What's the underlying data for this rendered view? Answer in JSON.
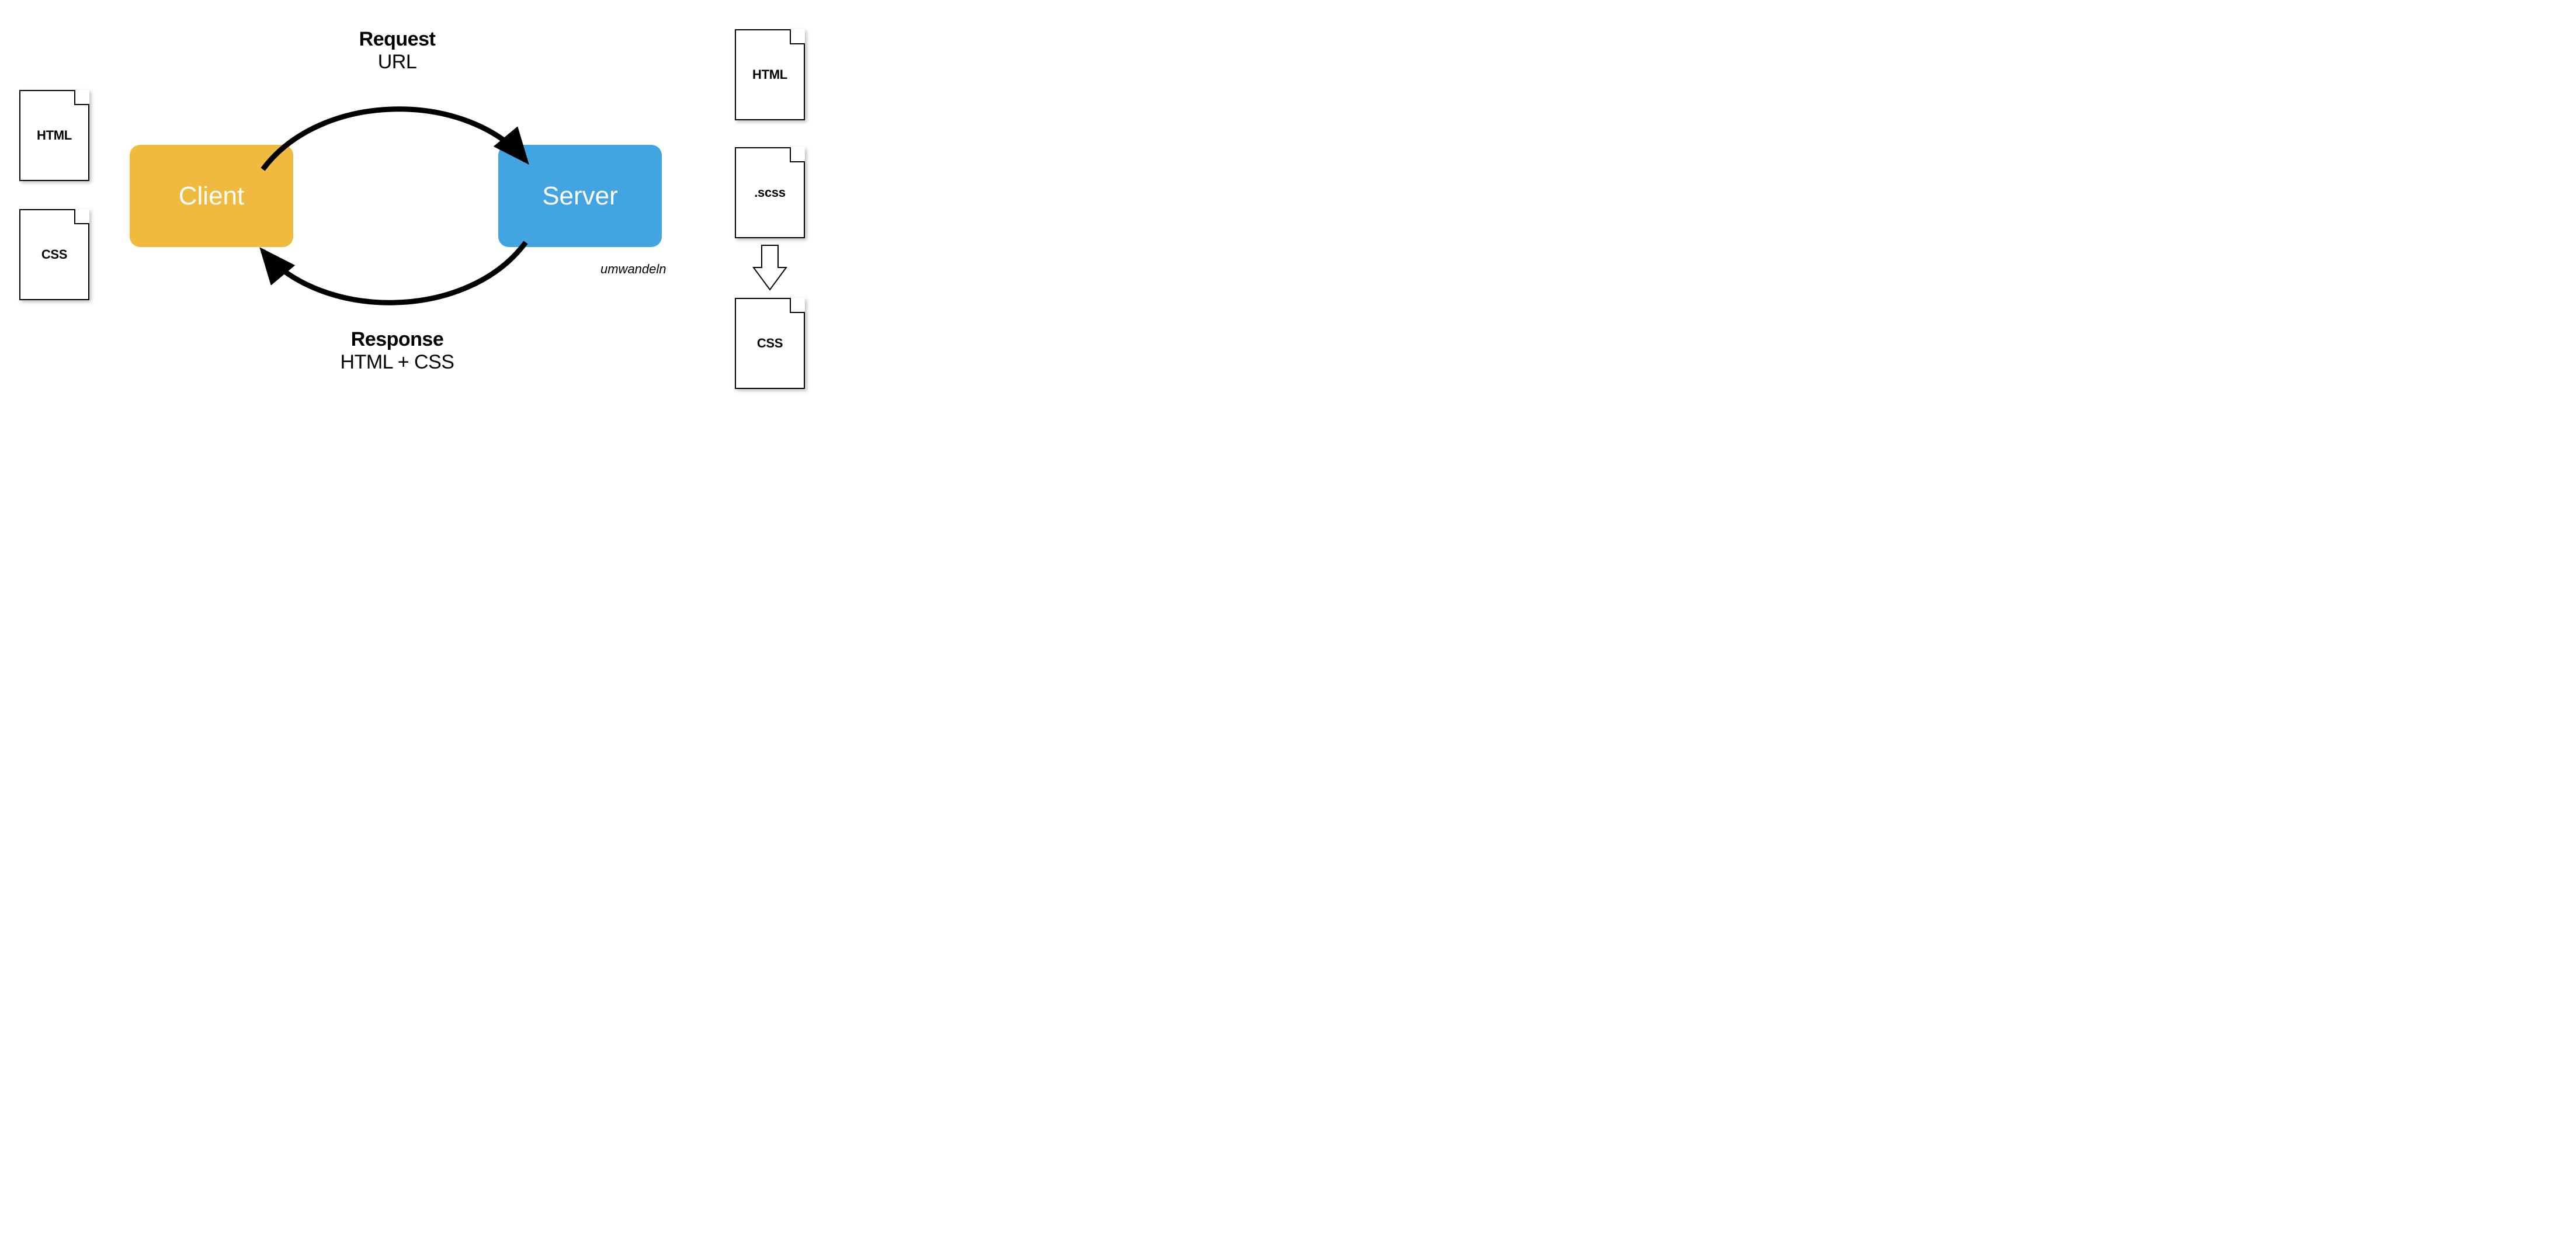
{
  "client": {
    "label": "Client",
    "files": [
      {
        "label": "HTML"
      },
      {
        "label": "CSS"
      }
    ]
  },
  "server": {
    "label": "Server",
    "files": [
      {
        "label": "HTML"
      },
      {
        "label": ".scss"
      },
      {
        "label": "CSS"
      }
    ],
    "transform_label": "umwandeln"
  },
  "request": {
    "title": "Request",
    "subtitle": "URL"
  },
  "response": {
    "title": "Response",
    "subtitle": "HTML + CSS"
  },
  "colors": {
    "client": "#efba3e",
    "server": "#42a5e2"
  }
}
